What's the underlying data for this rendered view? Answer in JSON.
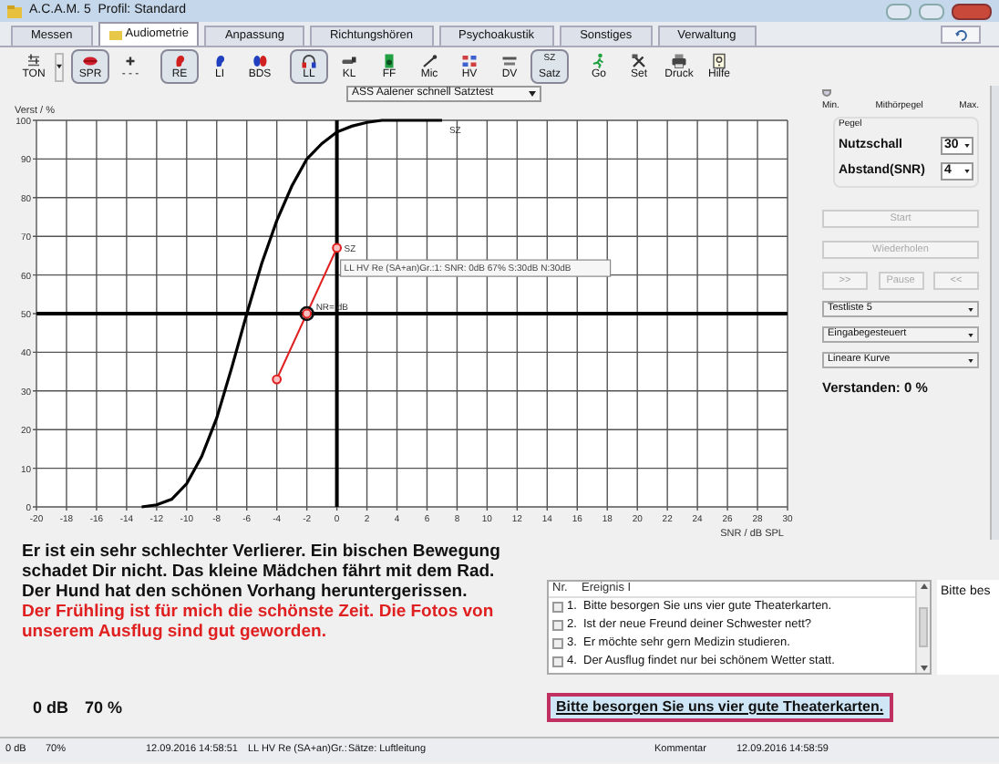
{
  "window": {
    "title": "A.C.A.M. 5  Profil: Standard"
  },
  "tabs": [
    {
      "label": "Messen",
      "selected": false
    },
    {
      "label": "Audiometrie",
      "selected": true
    },
    {
      "label": "Anpassung",
      "selected": false
    },
    {
      "label": "Richtungshören",
      "selected": false
    },
    {
      "label": "Psychoakustik",
      "selected": false
    },
    {
      "label": "Sonstiges",
      "selected": false
    },
    {
      "label": "Verwaltung",
      "selected": false
    }
  ],
  "toolbar": {
    "items": [
      {
        "label": "TON",
        "pressed": false
      },
      {
        "label": "SPR",
        "pressed": true
      },
      {
        "label": "- - -",
        "pressed": false
      },
      {
        "label": "RE",
        "pressed": true
      },
      {
        "label": "LI",
        "pressed": false
      },
      {
        "label": "BDS",
        "pressed": false
      },
      {
        "label": "LL",
        "pressed": true
      },
      {
        "label": "KL",
        "pressed": false
      },
      {
        "label": "FF",
        "pressed": false
      },
      {
        "label": "Mic",
        "pressed": false
      },
      {
        "label": "HV",
        "pressed": false
      },
      {
        "label": "DV",
        "pressed": false
      },
      {
        "label": "Satz",
        "pressed": true,
        "icon_text": "SZ"
      },
      {
        "label": "Go",
        "pressed": false
      },
      {
        "label": "Set",
        "pressed": false
      },
      {
        "label": "Druck",
        "pressed": false
      },
      {
        "label": "Hilfe",
        "pressed": false
      }
    ],
    "test_dropdown": "ASS Aalener schnell Satztest"
  },
  "chart": {
    "chart_data": {
      "type": "line",
      "xlabel": "SNR / dB SPL",
      "ylabel": "Verst / %",
      "x": [
        -13,
        -12,
        -11,
        -10,
        -9,
        -8,
        -7,
        -6,
        -5,
        -4,
        -3,
        -2,
        -1,
        0,
        1,
        2,
        3,
        4,
        5,
        6,
        7
      ],
      "grid": true,
      "series": [
        {
          "name": "SZ",
          "color": "#000000",
          "values": [
            0,
            0.5,
            2,
            6,
            13,
            23,
            36,
            50,
            63,
            74,
            83,
            90,
            94,
            97,
            98.5,
            99.5,
            100,
            100,
            100,
            100,
            100
          ]
        },
        {
          "name": "SZ",
          "color": "#e02020",
          "marker": "circle",
          "values": [
            null,
            null,
            null,
            null,
            null,
            null,
            null,
            null,
            null,
            33,
            null,
            50,
            null,
            67,
            null,
            null,
            null,
            null,
            null,
            null,
            null
          ]
        }
      ],
      "xlim": [
        -20,
        30
      ],
      "ylim": [
        0,
        100
      ],
      "xticks": [
        -20,
        -18,
        -16,
        -14,
        -12,
        -10,
        -8,
        -6,
        -4,
        -2,
        0,
        2,
        4,
        6,
        8,
        10,
        12,
        14,
        16,
        18,
        20,
        22,
        24,
        26,
        28,
        30
      ],
      "yticks": [
        0,
        10,
        20,
        30,
        40,
        50,
        60,
        70,
        80,
        90,
        100
      ],
      "annotations": [
        {
          "x": -2,
          "y": 50,
          "text": "NR= dB"
        }
      ]
    },
    "tooltip": "LL HV Re (SA+an)Gr.:1: SNR: 0dB 67% S:30dB N:30dB"
  },
  "control_panel": {
    "slider": {
      "labels": [
        "Min.",
        "Mithörpegel",
        "Max."
      ],
      "level": 0
    },
    "group_title": "Pegel",
    "fields": [
      {
        "label": "Nutzschall",
        "value": "30"
      },
      {
        "label": "Abstand(SNR)",
        "value": "4"
      }
    ],
    "buttons": [
      {
        "label": "Start",
        "disabled": true
      },
      {
        "label": "Wiederholen",
        "disabled": true
      }
    ],
    "transport": [
      {
        "label": ">>",
        "disabled": true
      },
      {
        "label": "Pause",
        "disabled": true
      },
      {
        "label": "<<",
        "disabled": true
      }
    ],
    "dropdowns": [
      "Testliste 5",
      "Eingabegesteuert",
      "Lineare Kurve"
    ],
    "result": "Verstanden: 0 %"
  },
  "sentences": [
    {
      "text": "Er ist ein sehr schlechter Verlierer. Ein bischen Bewegung schadet Dir nicht. Das kleine Mädchen fährt mit dem Rad. Der Hund hat den schönen Vorhang heruntergerissen.",
      "color": "#111111"
    },
    {
      "text": "Der Frühling ist für mich die schönste Zeit. Die Fotos von unserem Ausflug sind gut geworden.",
      "color": "#e02020"
    }
  ],
  "readout": [
    "0 dB",
    "70 %"
  ],
  "event_table": {
    "columns": [
      "Nr.",
      "Ereignis I"
    ],
    "rows": [
      {
        "nr": "1.",
        "text": "Bitte besorgen Sie uns vier gute Theaterkarten.",
        "checked": false
      },
      {
        "nr": "2.",
        "text": "Ist der neue Freund deiner Schwester nett?",
        "checked": false
      },
      {
        "nr": "3.",
        "text": "Er möchte sehr gern Medizin studieren.",
        "checked": false
      },
      {
        "nr": "4.",
        "text": "Der Ausflug findet nur bei schönem Wetter statt.",
        "checked": false
      }
    ]
  },
  "side_box": "Bitte bes",
  "current_sentence": "Bitte besorgen Sie uns vier gute Theaterkarten.",
  "status_bar": [
    "0 dB",
    "70%",
    "12.09.2016 14:58:51",
    "LL HV Re (SA+an)Gr.:",
    "Sätze: Luftleitung",
    "Kommentar",
    "12.09.2016 14:58:59"
  ]
}
